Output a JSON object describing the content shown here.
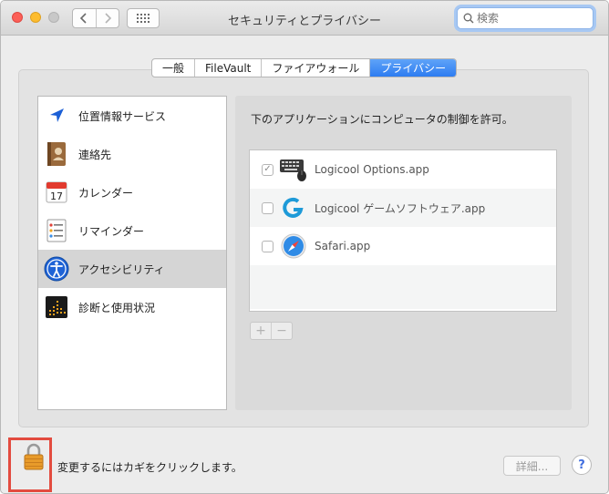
{
  "window": {
    "title": "セキュリティとプライバシー",
    "search": {
      "placeholder": "検索",
      "value": ""
    }
  },
  "tabs": [
    {
      "label": "一般",
      "active": false
    },
    {
      "label": "FileVault",
      "active": false
    },
    {
      "label": "ファイアウォール",
      "active": false
    },
    {
      "label": "プライバシー",
      "active": true
    }
  ],
  "sidebar": {
    "items": [
      {
        "label": "位置情報サービス",
        "icon": "location-arrow-icon",
        "selected": false
      },
      {
        "label": "連絡先",
        "icon": "contacts-book-icon",
        "selected": false
      },
      {
        "label": "カレンダー",
        "icon": "calendar-icon",
        "selected": false
      },
      {
        "label": "リマインダー",
        "icon": "reminders-list-icon",
        "selected": false
      },
      {
        "label": "アクセシビリティ",
        "icon": "accessibility-person-icon",
        "selected": true
      },
      {
        "label": "診断と使用状況",
        "icon": "diagnostics-icon",
        "selected": false
      }
    ]
  },
  "main": {
    "description": "下のアプリケーションにコンピュータの制御を許可。",
    "apps": [
      {
        "name": "Logicool Options.app",
        "checked": true,
        "icon": "keyboard-mouse-icon"
      },
      {
        "name": "Logicool ゲームソフトウェア.app",
        "checked": false,
        "icon": "logicool-g-icon"
      },
      {
        "name": "Safari.app",
        "checked": false,
        "icon": "safari-compass-icon"
      }
    ],
    "add_label": "+",
    "remove_label": "−"
  },
  "footer": {
    "lock_text": "変更するにはカギをクリックします。",
    "detail_button": "詳細...",
    "help_label": "?"
  },
  "colors": {
    "accent": "#2d7cf1",
    "lock_highlight": "#e34b3f",
    "close": "#fc5f57",
    "minimize": "#fdbc2e"
  }
}
